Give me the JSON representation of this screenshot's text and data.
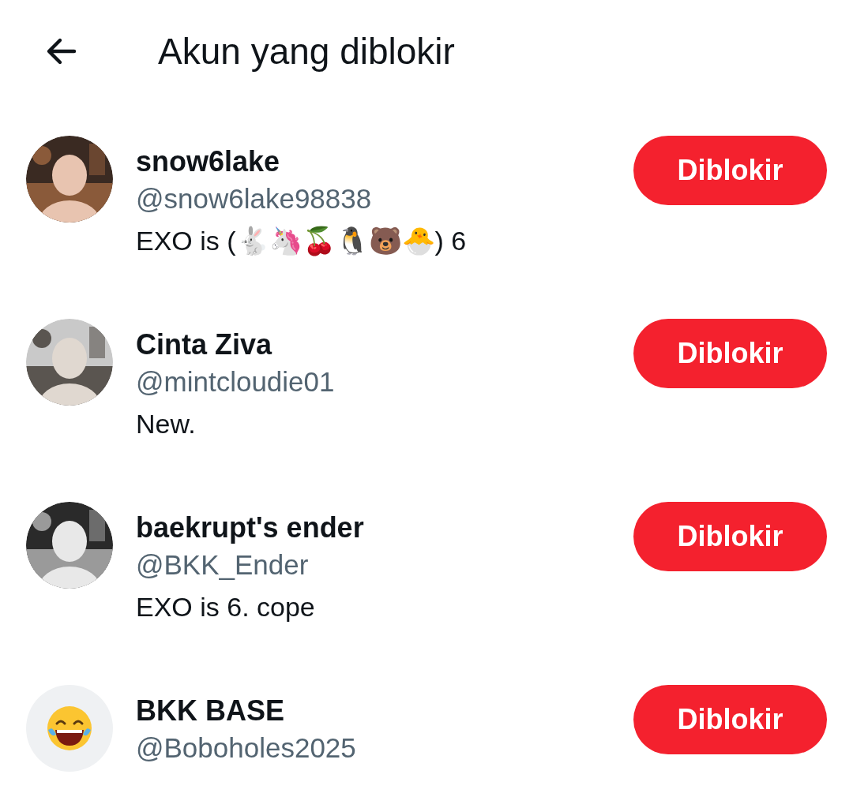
{
  "header": {
    "title": "Akun yang diblokir"
  },
  "accounts": [
    {
      "name": "snow6lake",
      "handle": "@snow6lake98838",
      "bio": "EXO is (🐇🦄🍒🐧🐻🐣) 6",
      "button": "Diblokir"
    },
    {
      "name": "Cinta Ziva",
      "handle": "@mintcloudie01",
      "bio": "New.",
      "button": "Diblokir"
    },
    {
      "name": "baekrupt's ender",
      "handle": "@BKK_Ender",
      "bio": "EXO is 6. cope",
      "button": "Diblokir"
    },
    {
      "avatar": {
        "kind": "emoji"
      },
      "name": "BKK BASE",
      "handle": "@Boboholes2025",
      "button": "Diblokir"
    }
  ]
}
